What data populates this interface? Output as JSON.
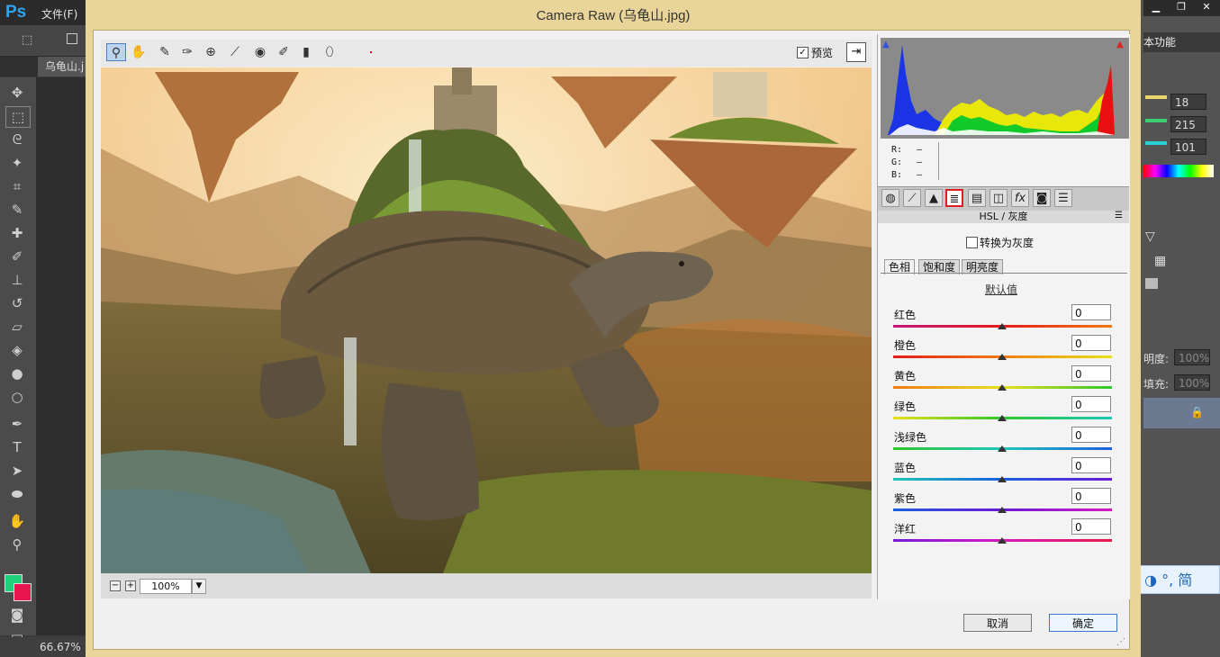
{
  "photoshop": {
    "logo": "Ps",
    "file_menu": "文件(F)",
    "doc_tab": "乌龟山.j",
    "zoom_status": "66.67%",
    "workspace": "本功能",
    "color_values": [
      "18",
      "215",
      "101"
    ],
    "opacity_label": "明度:",
    "opacity_value": "100%",
    "fill_label": "填充:",
    "fill_value": "100%",
    "fg_color": "#1fd07a",
    "bg_color": "#e8154e"
  },
  "dialog": {
    "title": "Camera Raw (乌龟山.jpg)",
    "preview_label": "预览",
    "zoom_value": "100%",
    "cancel_label": "取消",
    "ok_label": "确定"
  },
  "readout": {
    "r_label": "R:",
    "g_label": "G:",
    "b_label": "B:",
    "r_value": "—",
    "g_value": "—",
    "b_value": "—"
  },
  "panel": {
    "title": "HSL / 灰度",
    "convert_gray_label": "转换为灰度",
    "tabs": [
      "色相",
      "饱和度",
      "明亮度"
    ],
    "default_link": "默认值",
    "sliders": [
      {
        "label": "红色",
        "value": "0"
      },
      {
        "label": "橙色",
        "value": "0"
      },
      {
        "label": "黄色",
        "value": "0"
      },
      {
        "label": "绿色",
        "value": "0"
      },
      {
        "label": "浅绿色",
        "value": "0"
      },
      {
        "label": "蓝色",
        "value": "0"
      },
      {
        "label": "紫色",
        "value": "0"
      },
      {
        "label": "洋红",
        "value": "0"
      }
    ]
  },
  "ime": {
    "text": "英 ◑ °, 简"
  }
}
